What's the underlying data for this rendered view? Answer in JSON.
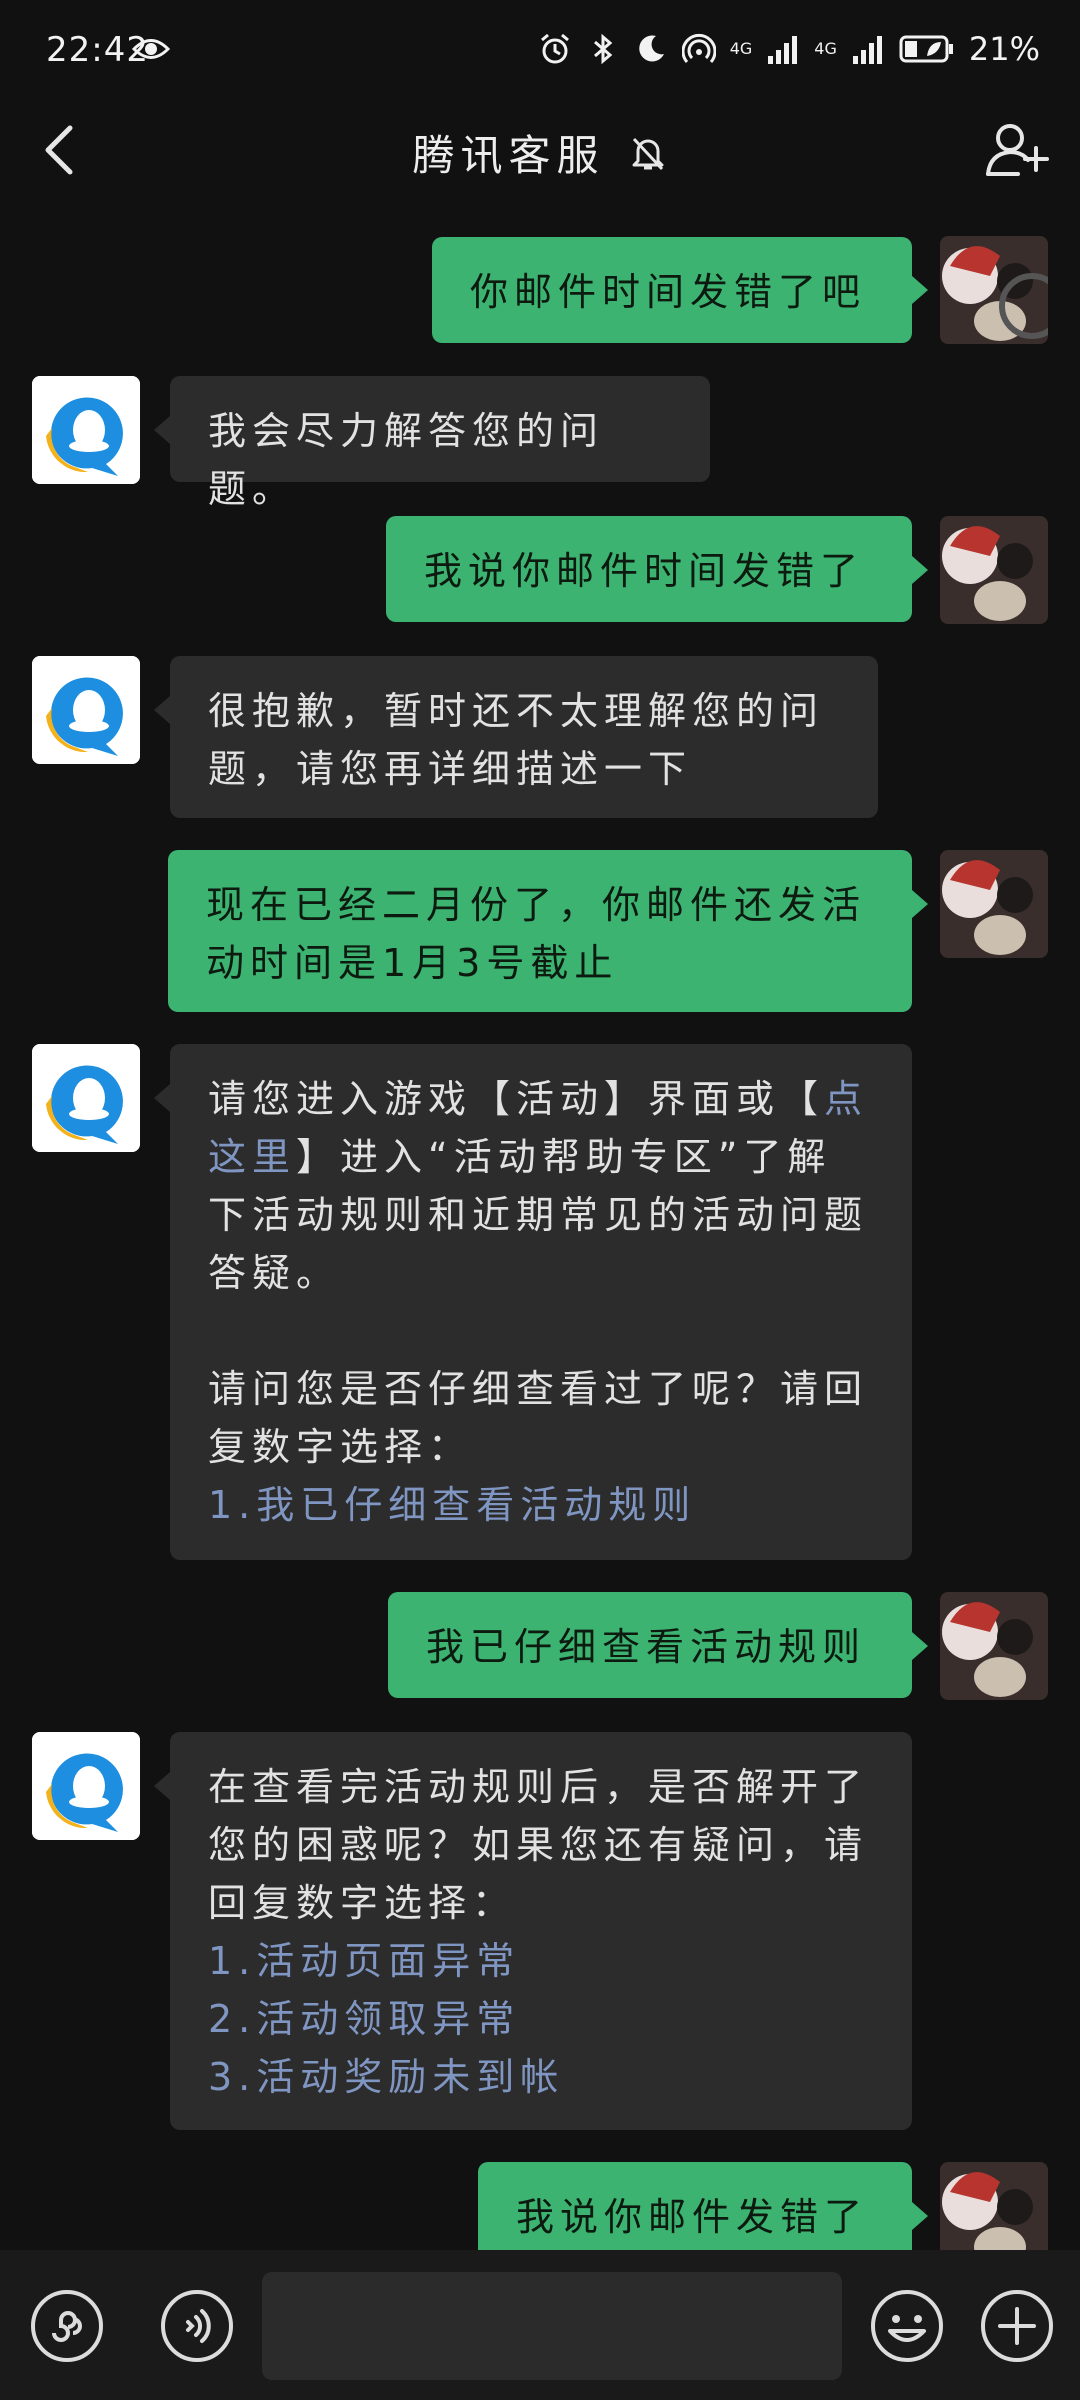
{
  "status_bar": {
    "time": "22:42",
    "battery_pct": "21%",
    "network_a": "4G",
    "network_b": "4G",
    "icons": [
      "eye-icon",
      "alarm-icon",
      "bluetooth-icon",
      "moon-icon",
      "hotspot-icon",
      "signal-icon",
      "battery-icon"
    ]
  },
  "header": {
    "title": "腾讯客服",
    "icons": [
      "back-arrow-icon",
      "mute-bell-icon",
      "add-user-icon"
    ]
  },
  "messages": [
    {
      "sender": "me",
      "text": "你邮件时间发错了吧"
    },
    {
      "sender": "bot",
      "text": "我会尽力解答您的问题。"
    },
    {
      "sender": "me",
      "text": "我说你邮件时间发错了"
    },
    {
      "sender": "bot",
      "lines": [
        "很抱歉，暂时还不太理解您的问",
        "题，请您再详细描述一下"
      ]
    },
    {
      "sender": "me",
      "lines": [
        "现在已经二月份了，你邮件还发活",
        "动时间是1月3号截止"
      ]
    },
    {
      "sender": "bot",
      "p1": {
        "pre": "请您进入游戏【活动】界面或【",
        "link": "点这里",
        "post": "】进入“活动帮助专区”了解下活动规则和近期常见的活动问题答疑。"
      },
      "p2": "请问您是否仔细查看过了呢？请回复数字选择：",
      "options": [
        "1.我已仔细查看活动规则"
      ]
    },
    {
      "sender": "me",
      "text": "我已仔细查看活动规则"
    },
    {
      "sender": "bot",
      "p1": "在查看完活动规则后，是否解开了您的困惑呢？如果您还有疑问，请回复数字选择：",
      "options": [
        "1.活动页面异常",
        "2.活动领取异常",
        "3.活动奖励未到帐"
      ]
    },
    {
      "sender": "me",
      "text": "我说你邮件发错了"
    }
  ],
  "input_bar": {
    "input_value": "",
    "icons": [
      "mini-program-icon",
      "voice-icon",
      "emoji-icon",
      "plus-icon"
    ]
  },
  "colors": {
    "background": "#111111",
    "my_bubble": "#3cb371",
    "bot_bubble": "#2c2c2c",
    "link": "#8096c2",
    "bot_avatar_blue": "#1e8fe0",
    "bot_avatar_yellow": "#f3b11a"
  }
}
